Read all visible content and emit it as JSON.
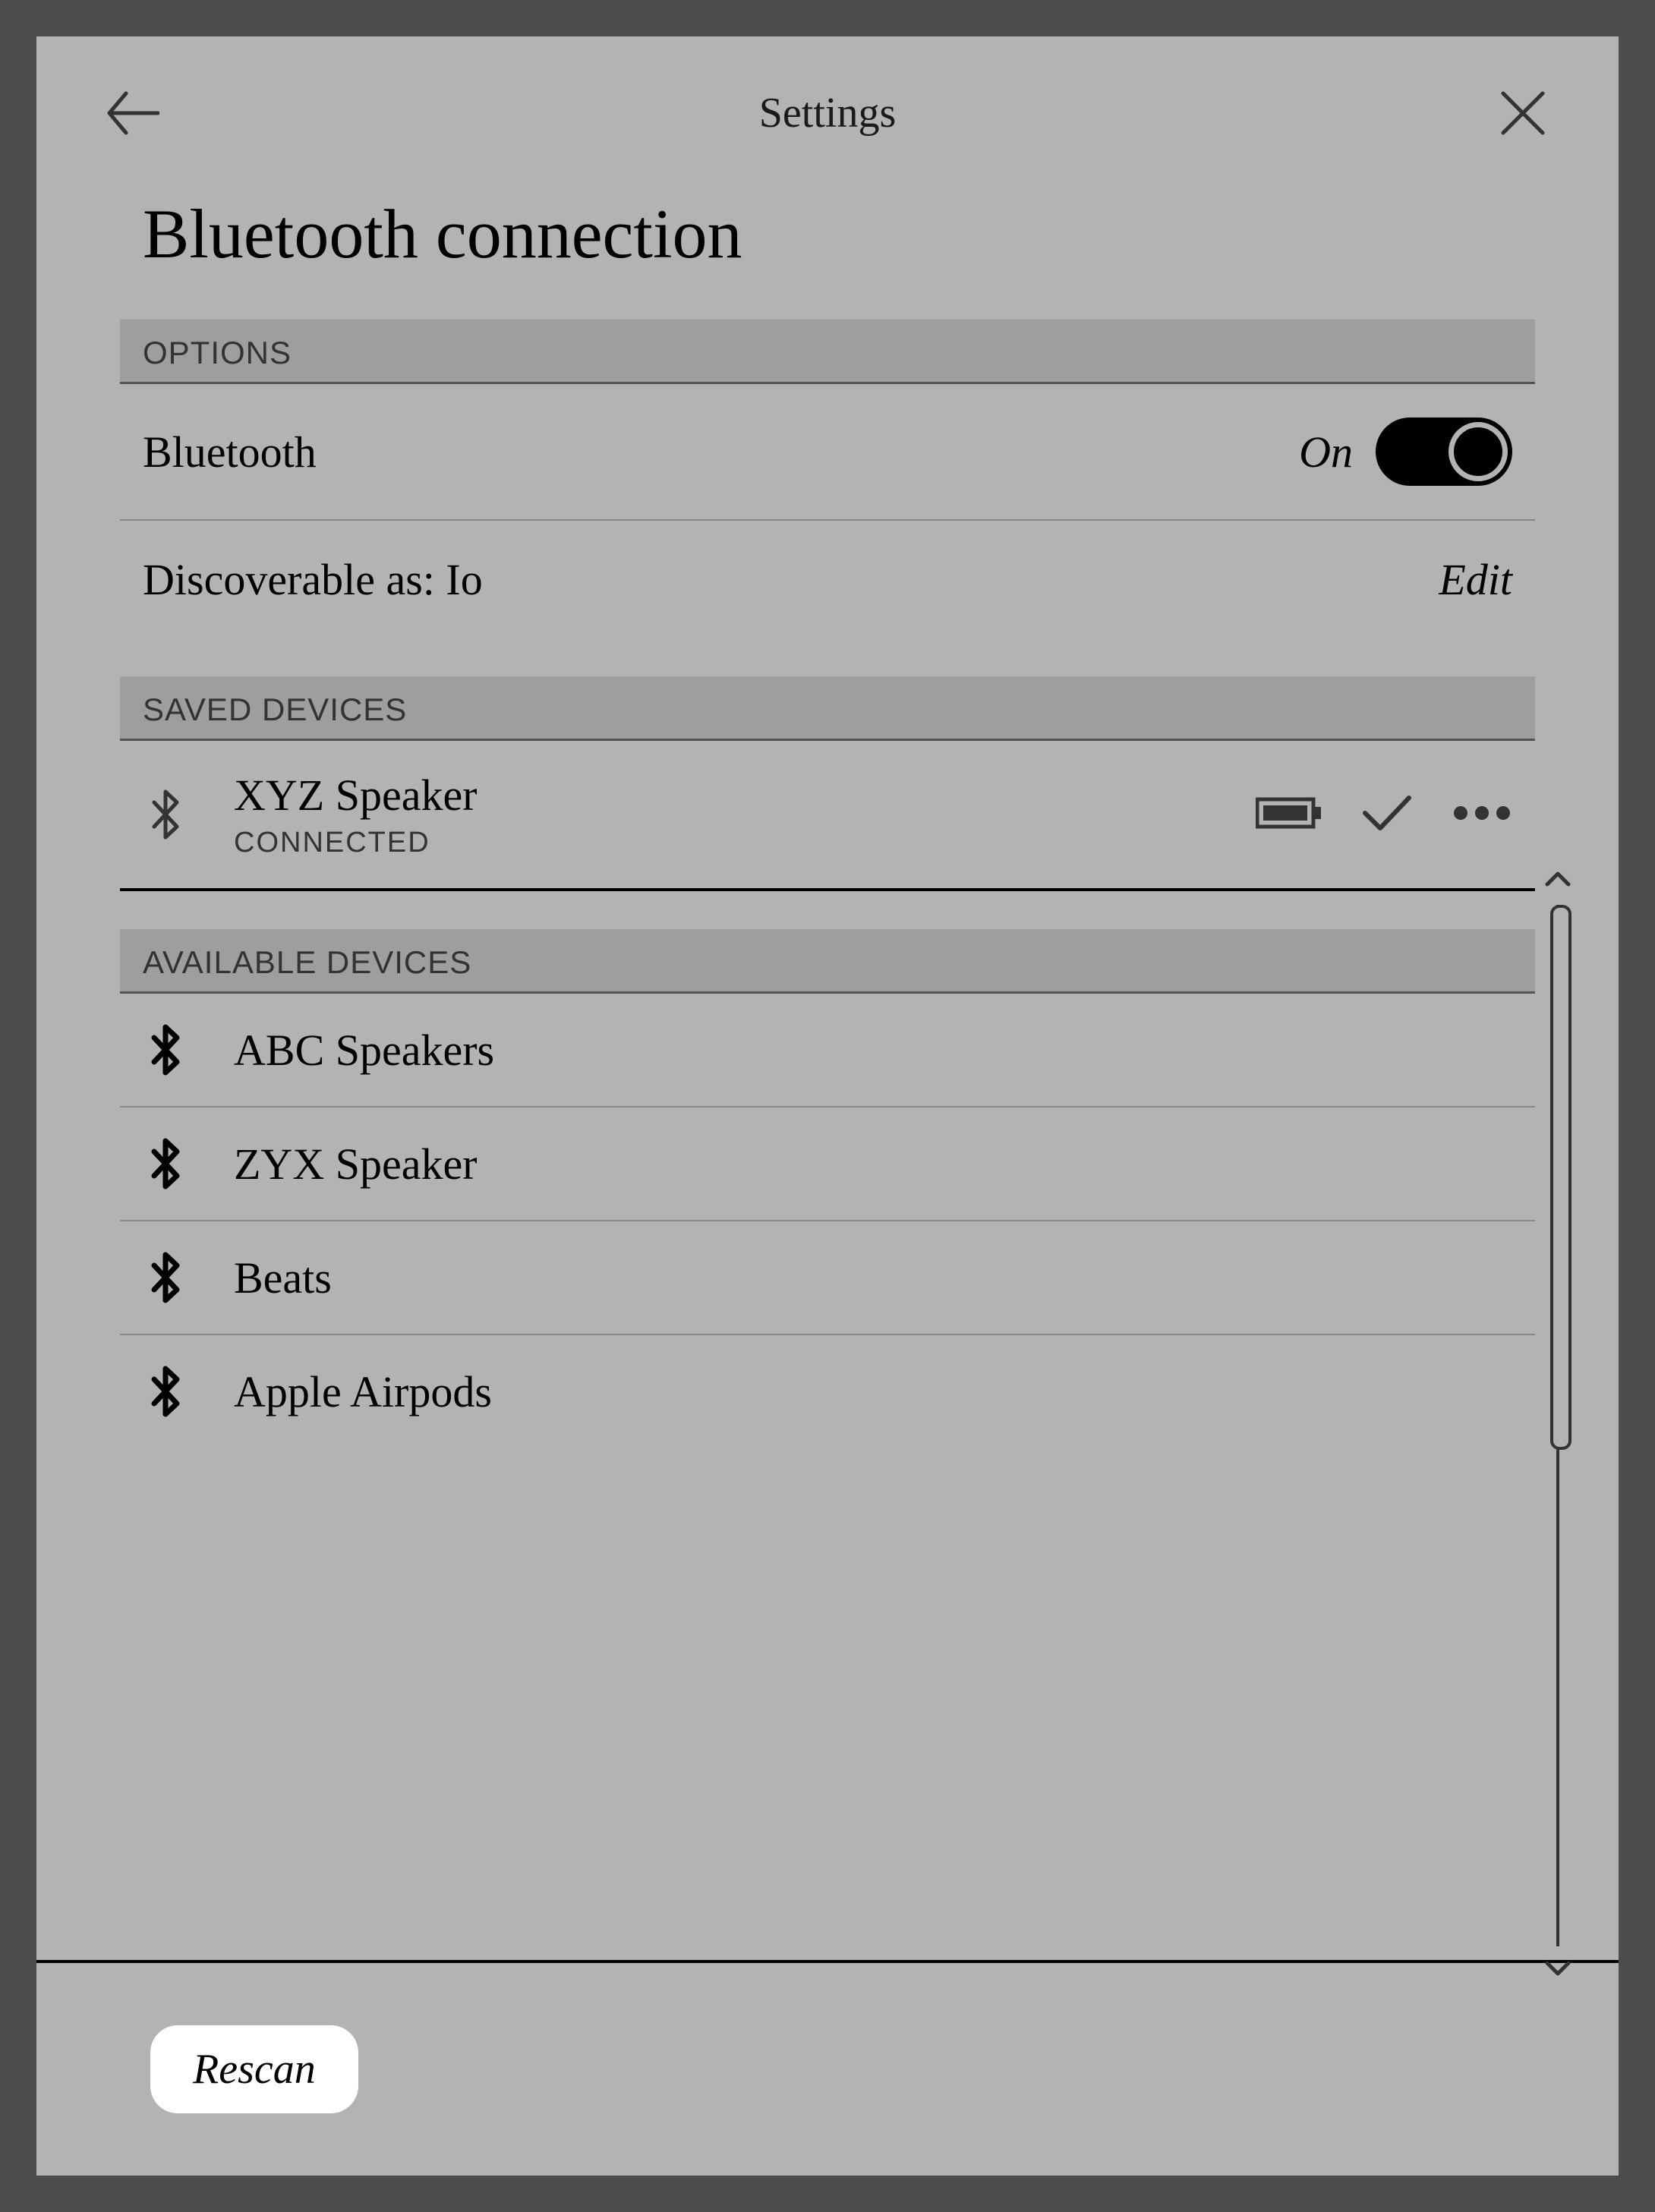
{
  "header": {
    "title": "Settings"
  },
  "page_title": "Bluetooth connection",
  "sections": {
    "options_header": "OPTIONS",
    "bluetooth_label": "Bluetooth",
    "bluetooth_state": "On",
    "discoverable_label": "Discoverable as: Io",
    "edit_label": "Edit",
    "saved_header": "SAVED DEVICES",
    "available_header": "AVAILABLE DEVICES"
  },
  "saved_devices": [
    {
      "name": "XYZ Speaker",
      "status": "CONNECTED"
    }
  ],
  "available_devices": [
    {
      "name": "ABC Speakers"
    },
    {
      "name": "ZYX Speaker"
    },
    {
      "name": "Beats"
    },
    {
      "name": "Apple Airpods"
    }
  ],
  "footer": {
    "rescan": "Rescan"
  }
}
